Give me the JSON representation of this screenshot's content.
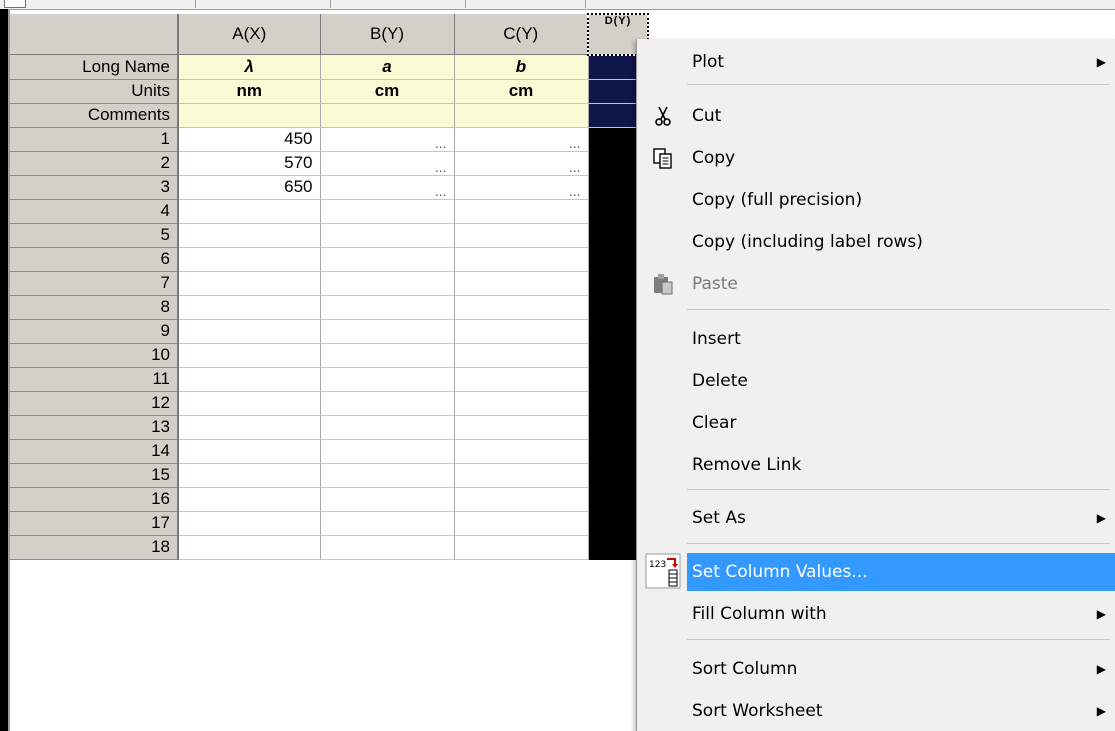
{
  "worksheet": {
    "columns": [
      {
        "header": "A(X)",
        "long_name": "λ",
        "units": "nm",
        "comments": ""
      },
      {
        "header": "B(Y)",
        "long_name": "a",
        "units": "cm",
        "comments": ""
      },
      {
        "header": "C(Y)",
        "long_name": "b",
        "units": "cm",
        "comments": ""
      },
      {
        "header": "D(Y)",
        "long_name": "",
        "units": "",
        "comments": ""
      }
    ],
    "label_rows": [
      "Long Name",
      "Units",
      "Comments"
    ],
    "row_numbers": [
      "1",
      "2",
      "3",
      "4",
      "5",
      "6",
      "7",
      "8",
      "9",
      "10",
      "11",
      "12",
      "13",
      "14",
      "15",
      "16",
      "17",
      "18"
    ],
    "data": [
      [
        "450",
        "...",
        "..."
      ],
      [
        "570",
        "...",
        "..."
      ],
      [
        "650",
        "...",
        "..."
      ]
    ]
  },
  "context_menu": {
    "items": [
      {
        "label": "Plot",
        "submenu": true
      },
      {
        "label": "Cut",
        "icon": "scissors-icon"
      },
      {
        "label": "Copy",
        "icon": "copy-icon"
      },
      {
        "label": "Copy (full precision)"
      },
      {
        "label": "Copy (including label rows)"
      },
      {
        "label": "Paste",
        "icon": "paste-icon",
        "disabled": true
      },
      {
        "label": "Insert"
      },
      {
        "label": "Delete"
      },
      {
        "label": "Clear"
      },
      {
        "label": "Remove Link"
      },
      {
        "label": "Set As",
        "submenu": true
      },
      {
        "label": "Set Column Values...",
        "icon": "set-column-values-icon",
        "highlighted": true
      },
      {
        "label": "Fill Column with",
        "submenu": true
      },
      {
        "label": "Sort Column",
        "submenu": true
      },
      {
        "label": "Sort Worksheet",
        "submenu": true
      }
    ],
    "highlight_color": "#3399ff"
  }
}
